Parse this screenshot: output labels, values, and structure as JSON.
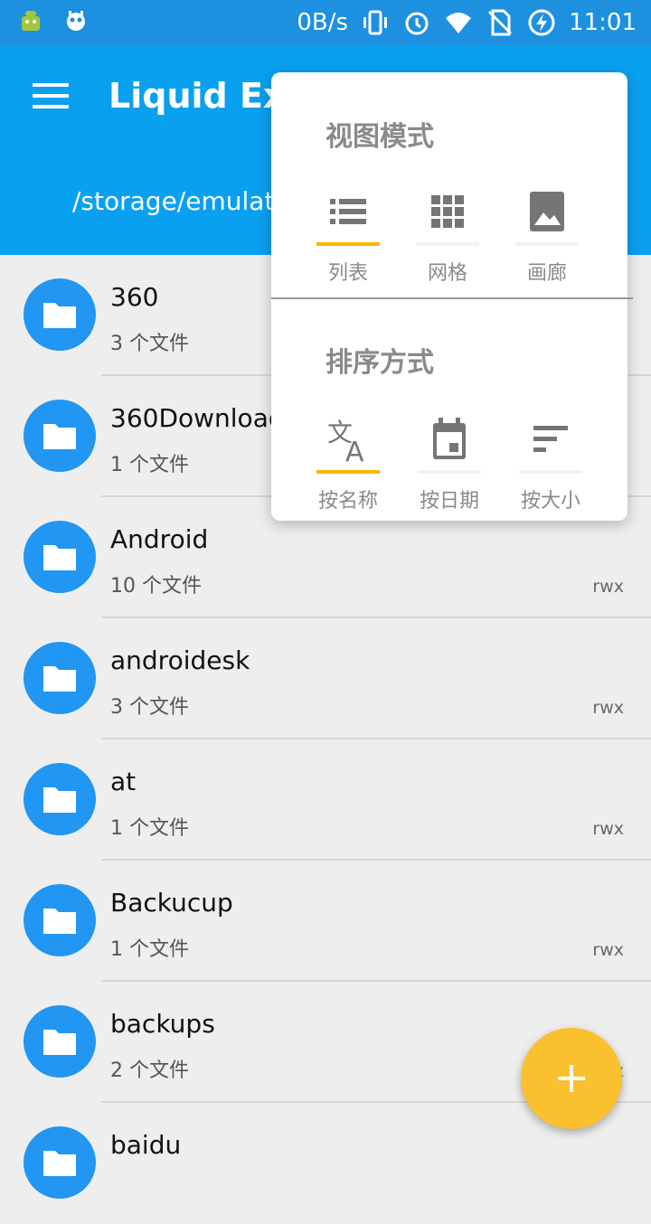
{
  "status_bar": {
    "net_speed": "0B/s",
    "time": "11:01",
    "icons": [
      "android-debug-icon",
      "cyanogen-icon",
      "vibrate-icon",
      "alarm-icon",
      "wifi-icon",
      "no-sim-icon",
      "battery-charging-icon"
    ]
  },
  "app_bar": {
    "title": "Liquid Exp",
    "path": "/storage/emulate",
    "menu_icon": "hamburger-menu-icon"
  },
  "files": [
    {
      "name": "360",
      "count": "3 个文件",
      "perm": ""
    },
    {
      "name": "360Download",
      "count": "1 个文件",
      "perm": ""
    },
    {
      "name": "Android",
      "count": "10 个文件",
      "perm": "rwx"
    },
    {
      "name": "androidesk",
      "count": "3 个文件",
      "perm": "rwx"
    },
    {
      "name": "at",
      "count": "1 个文件",
      "perm": "rwx"
    },
    {
      "name": "Backucup",
      "count": "1 个文件",
      "perm": "rwx"
    },
    {
      "name": "backups",
      "count": "2 个文件",
      "perm": "x"
    },
    {
      "name": "baidu",
      "count": "",
      "perm": ""
    }
  ],
  "popup": {
    "view_title": "视图模式",
    "view_options": [
      {
        "label": "列表",
        "icon": "list-view-icon",
        "selected": true
      },
      {
        "label": "网格",
        "icon": "grid-view-icon",
        "selected": false
      },
      {
        "label": "画廊",
        "icon": "gallery-view-icon",
        "selected": false
      }
    ],
    "sort_title": "排序方式",
    "sort_options": [
      {
        "label": "按名称",
        "icon": "translate-az-icon",
        "selected": true
      },
      {
        "label": "按日期",
        "icon": "calendar-icon",
        "selected": false
      },
      {
        "label": "按大小",
        "icon": "sort-size-icon",
        "selected": false
      }
    ]
  },
  "fab": {
    "label": "+",
    "icon": "add-icon"
  },
  "colors": {
    "primary": "#0aa0f0",
    "status": "#1e90e0",
    "folder": "#2196f3",
    "accent": "#fbc02d",
    "selected": "#f5b800"
  }
}
